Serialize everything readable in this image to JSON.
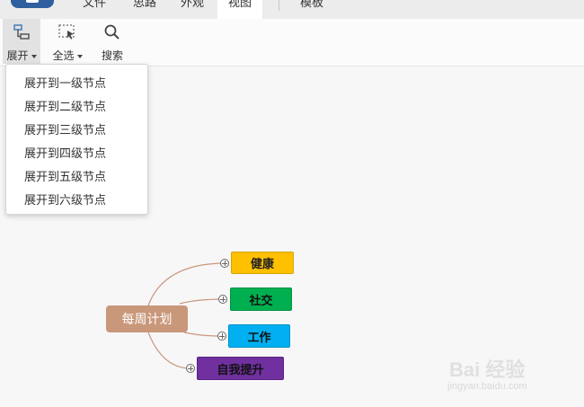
{
  "menu": {
    "items": [
      "文件",
      "思路",
      "外观",
      "视图",
      "模板"
    ],
    "active": "视图"
  },
  "toolbar": {
    "expand_label": "展开",
    "select_all_label": "全选",
    "search_label": "搜索"
  },
  "dropdown": {
    "options": [
      "展开到一级节点",
      "展开到二级节点",
      "展开到三级节点",
      "展开到四级节点",
      "展开到五级节点",
      "展开到六级节点"
    ]
  },
  "mindmap": {
    "root": {
      "label": "每周计划",
      "color": "#c9977a"
    },
    "children": [
      {
        "label": "健康",
        "color": "#ffc000"
      },
      {
        "label": "社交",
        "color": "#00b050"
      },
      {
        "label": "工作",
        "color": "#00b0f0"
      },
      {
        "label": "自我提升",
        "color": "#7030a0"
      }
    ]
  },
  "watermark": {
    "text": "Bai 经验",
    "url": "jingyan.baidu.com"
  }
}
